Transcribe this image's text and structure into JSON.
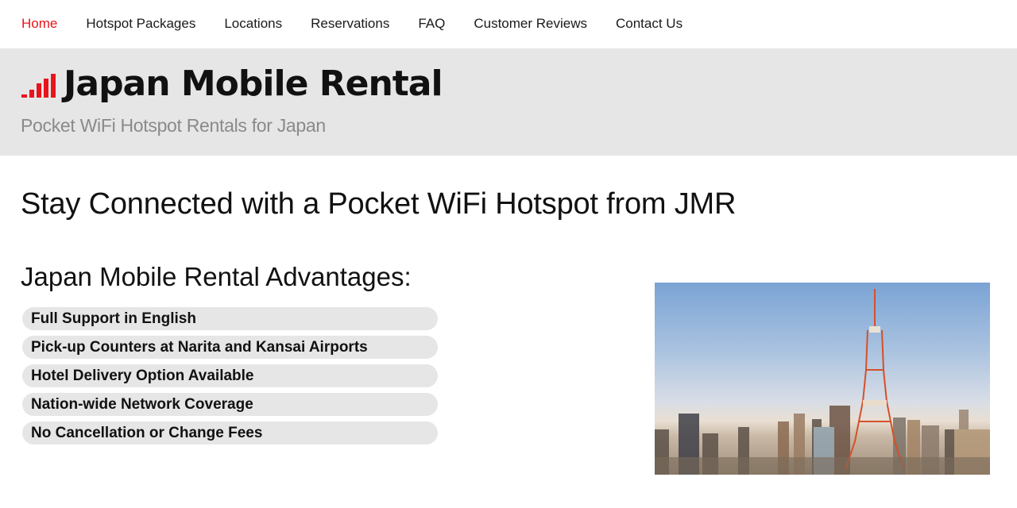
{
  "nav": {
    "items": [
      {
        "label": "Home",
        "active": true
      },
      {
        "label": "Hotspot Packages",
        "active": false
      },
      {
        "label": "Locations",
        "active": false
      },
      {
        "label": "Reservations",
        "active": false
      },
      {
        "label": "FAQ",
        "active": false
      },
      {
        "label": "Customer Reviews",
        "active": false
      },
      {
        "label": "Contact Us",
        "active": false
      }
    ]
  },
  "banner": {
    "logo_icon": "signal-bars-icon",
    "logo_text": "Japan Mobile Rental",
    "tagline": "Pocket WiFi Hotspot Rentals for Japan"
  },
  "main": {
    "headline": "Stay Connected with a Pocket WiFi Hotspot from JMR",
    "advantages_title": "Japan Mobile Rental Advantages:",
    "advantages": [
      "Full Support in English",
      "Pick-up Counters at Narita and Kansai Airports",
      "Hotel Delivery Option Available",
      "Nation-wide Network Coverage",
      "No Cancellation or Change Fees"
    ],
    "image_alt": "Tokyo Tower and city skyline"
  },
  "colors": {
    "accent": "#e8141c",
    "banner_bg": "#e6e6e6",
    "pill_bg": "#e6e6e6",
    "tagline": "#8a8a8a"
  }
}
